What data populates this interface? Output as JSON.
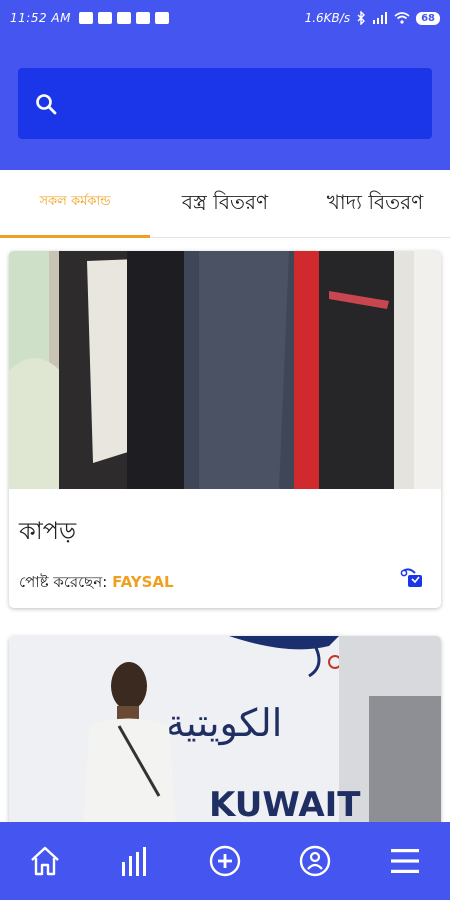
{
  "status_bar": {
    "time": "11:52 AM",
    "speed": "1.6KB/s",
    "battery": "68"
  },
  "search": {
    "placeholder": "",
    "value": ""
  },
  "tabs": [
    {
      "label": "সকল কর্মকান্ড",
      "active": true
    },
    {
      "label": "বস্ত্র বিতরণ",
      "active": false
    },
    {
      "label": "খাদ্য বিতরণ",
      "active": false
    }
  ],
  "cards": [
    {
      "title": "কাপড়",
      "posted_by_label": "পোষ্ট করেছেন:",
      "posted_by": "FAYSAL"
    },
    {
      "title": "",
      "posted_by_label": "",
      "posted_by": ""
    }
  ],
  "card_images": {
    "card2_text_arabic": "الكويتية",
    "card2_text_latin": "KUWAIT"
  },
  "bottom_nav": [
    {
      "icon": "home-icon"
    },
    {
      "icon": "bar-chart-icon"
    },
    {
      "icon": "add-circle-icon"
    },
    {
      "icon": "profile-icon"
    },
    {
      "icon": "menu-icon"
    }
  ],
  "colors": {
    "primary": "#4556f0",
    "search_bg": "#1b35e8",
    "accent": "#f0a020"
  }
}
